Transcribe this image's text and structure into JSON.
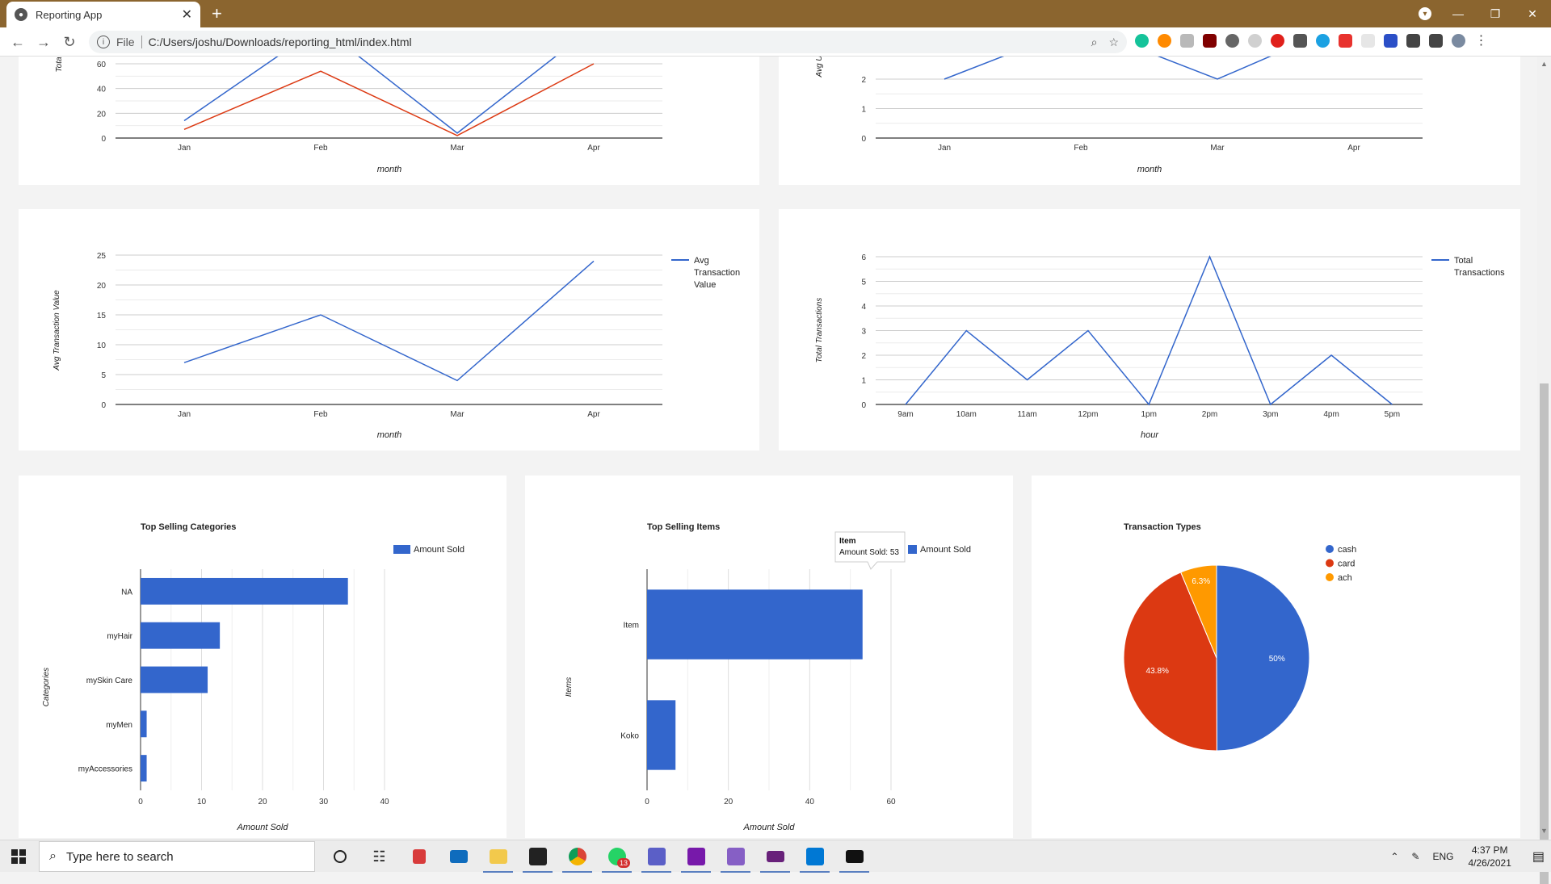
{
  "browser": {
    "tab_title": "Reporting App",
    "file_label": "File",
    "url": "C:/Users/joshu/Downloads/reporting_html/index.html"
  },
  "charts": {
    "top_left": {
      "ylabel": "Tota",
      "xlabel": "month",
      "categories": [
        "Jan",
        "Feb",
        "Mar",
        "Apr"
      ],
      "y_ticks": [
        "0",
        "20",
        "40",
        "60"
      ],
      "chart_data": {
        "type": "line",
        "categories": [
          "Jan",
          "Feb",
          "Mar",
          "Apr"
        ],
        "series": [
          {
            "values": [
              14,
              90,
              4,
              90
            ],
            "color": "#3366cc"
          },
          {
            "values": [
              7,
              54,
              2,
              60
            ],
            "color": "#dc3912"
          }
        ],
        "ylim": [
          0,
          60
        ]
      }
    },
    "top_right": {
      "ylabel": "Avg U",
      "xlabel": "month",
      "categories": [
        "Jan",
        "Feb",
        "Mar",
        "Apr"
      ],
      "y_ticks": [
        "0",
        "1",
        "2"
      ],
      "chart_data": {
        "type": "line",
        "categories": [
          "Jan",
          "Feb",
          "Mar",
          "Apr"
        ],
        "series": [
          {
            "values": [
              2,
              3.8,
              2,
              4
            ],
            "color": "#3366cc"
          }
        ],
        "ylim": [
          0,
          2
        ]
      }
    },
    "avg_transaction": {
      "ylabel": "Avg Transaction Value",
      "xlabel": "month",
      "legend": [
        "Avg",
        "Transaction",
        "Value"
      ],
      "categories": [
        "Jan",
        "Feb",
        "Mar",
        "Apr"
      ],
      "y_ticks": [
        "0",
        "5",
        "10",
        "15",
        "20",
        "25"
      ],
      "chart_data": {
        "type": "line",
        "categories": [
          "Jan",
          "Feb",
          "Mar",
          "Apr"
        ],
        "series": [
          {
            "name": "Avg Transaction Value",
            "values": [
              7,
              15,
              4,
              24
            ],
            "color": "#3366cc"
          }
        ],
        "ylim": [
          0,
          25
        ]
      }
    },
    "total_transactions": {
      "ylabel": "Total Transactions",
      "xlabel": "hour",
      "legend": [
        "Total",
        "Transactions"
      ],
      "categories": [
        "9am",
        "10am",
        "11am",
        "12pm",
        "1pm",
        "2pm",
        "3pm",
        "4pm",
        "5pm"
      ],
      "y_ticks": [
        "0",
        "1",
        "2",
        "3",
        "4",
        "5",
        "6"
      ],
      "chart_data": {
        "type": "line",
        "categories": [
          "9am",
          "10am",
          "11am",
          "12pm",
          "1pm",
          "2pm",
          "3pm",
          "4pm",
          "5pm"
        ],
        "series": [
          {
            "name": "Total Transactions",
            "values": [
              0,
              3,
              1,
              3,
              0,
              6,
              0,
              2,
              0
            ],
            "color": "#3366cc"
          }
        ],
        "ylim": [
          0,
          6
        ]
      }
    },
    "top_categories": {
      "title": "Top Selling Categories",
      "ylabel": "Categories",
      "xlabel": "Amount Sold",
      "legend": "Amount Sold",
      "x_ticks": [
        "0",
        "10",
        "20",
        "30",
        "40"
      ],
      "chart_data": {
        "type": "bar",
        "categories": [
          "NA",
          "myHair",
          "mySkin Care",
          "myMen",
          "myAccessories"
        ],
        "series": [
          {
            "name": "Amount Sold",
            "values": [
              34,
              13,
              11,
              1,
              1
            ],
            "color": "#3366cc"
          }
        ],
        "xlim": [
          0,
          40
        ]
      }
    },
    "top_items": {
      "title": "Top Selling Items",
      "ylabel": "Items",
      "xlabel": "Amount Sold",
      "legend": "Amount Sold",
      "x_ticks": [
        "0",
        "20",
        "40",
        "60"
      ],
      "tooltip": {
        "title": "Item",
        "text": "Amount Sold: 53"
      },
      "chart_data": {
        "type": "bar",
        "categories": [
          "Item",
          "Koko"
        ],
        "series": [
          {
            "name": "Amount Sold",
            "values": [
              53,
              7
            ],
            "color": "#3366cc"
          }
        ],
        "xlim": [
          0,
          60
        ]
      }
    },
    "transaction_types": {
      "title": "Transaction Types",
      "legend": [
        "cash",
        "card",
        "ach"
      ],
      "slice_labels": [
        "50%",
        "43.8%",
        "6.3%"
      ],
      "chart_data": {
        "type": "pie",
        "categories": [
          "cash",
          "card",
          "ach"
        ],
        "values": [
          50,
          43.8,
          6.3
        ],
        "colors": [
          "#3366cc",
          "#dc3912",
          "#ff9900"
        ]
      }
    }
  },
  "taskbar": {
    "search_placeholder": "Type here to search",
    "language": "ENG",
    "time": "4:37 PM",
    "date": "4/26/2021",
    "badge": "13"
  }
}
